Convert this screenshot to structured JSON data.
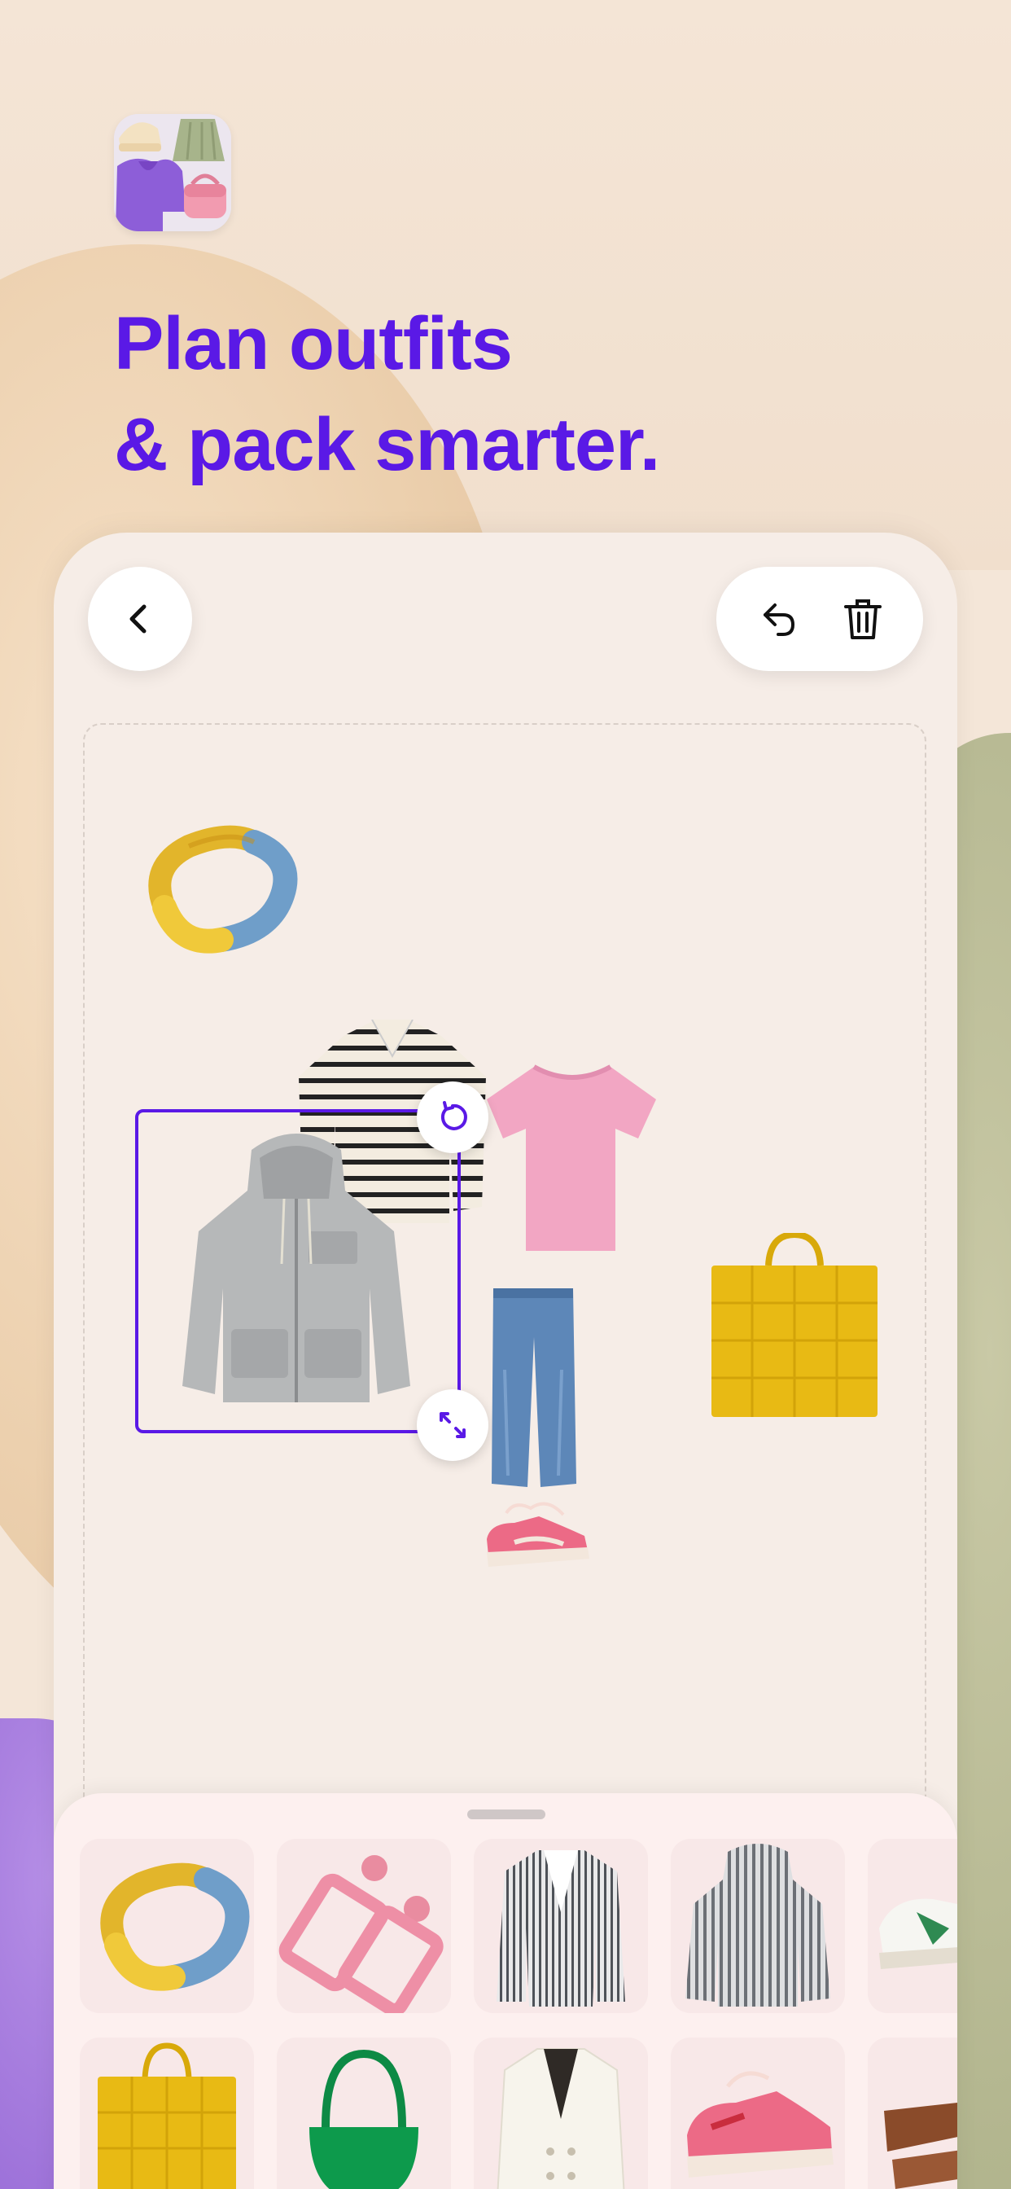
{
  "headline": {
    "line1": "Plan outfits",
    "line2": "& pack smarter."
  },
  "colors": {
    "accent": "#5a19e6",
    "background": "#f4e6d8",
    "card": "#f6ede7",
    "sheet": "#fdf0ef",
    "tile": "#f8e8e8"
  },
  "toolbar": {
    "back_icon": "chevron-left-icon",
    "undo_icon": "undo-icon",
    "delete_icon": "trash-icon"
  },
  "canvas": {
    "items": [
      "bangle",
      "striped-sweater",
      "pink-tshirt",
      "gray-jacket",
      "jeans",
      "sneakers",
      "yellow-tote"
    ],
    "selected_item": "gray-jacket",
    "handles": [
      "rotate-icon",
      "resize-icon"
    ]
  },
  "closet": {
    "row1": [
      "bangle",
      "pink-earrings",
      "striped-blazer",
      "striped-jacket",
      "green-sneakers"
    ],
    "row2": [
      "yellow-tote",
      "green-bag",
      "white-blazer",
      "pink-sneakers",
      "brown-sandals"
    ]
  }
}
